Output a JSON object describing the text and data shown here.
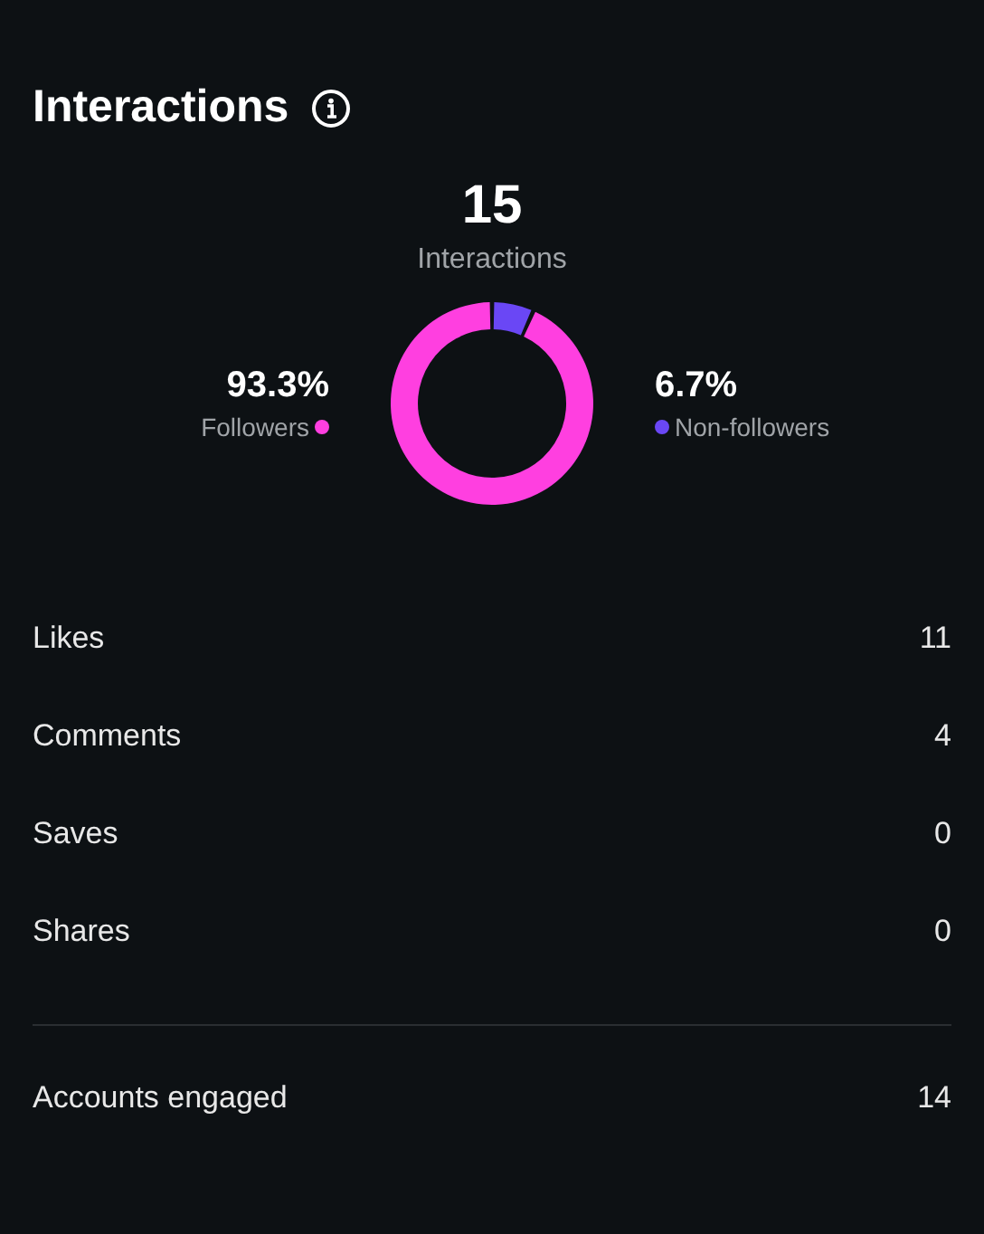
{
  "title": "Interactions",
  "total": {
    "value": "15",
    "label": "Interactions"
  },
  "legend": [
    {
      "value": "93.3%",
      "color": "#ff3fe0"
    },
    {
      "value": "6.7%",
      "color": "#6a47f5"
    }
  ],
  "chart_data": {
    "type": "donut",
    "categories": [
      "Followers",
      "Non-followers"
    ],
    "values": [
      93.3,
      6.7
    ]
  },
  "metrics": [
    {
      "label": "Likes",
      "value": "11"
    },
    {
      "label": "Comments",
      "value": "4"
    },
    {
      "label": "Saves",
      "value": "0"
    },
    {
      "label": "Shares",
      "value": "0"
    }
  ],
  "summary": {
    "label": "Accounts engaged",
    "value": "14"
  }
}
